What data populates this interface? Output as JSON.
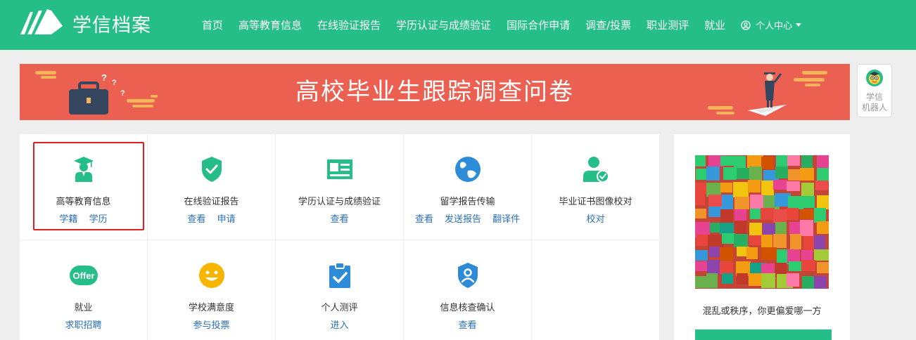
{
  "header": {
    "logo_text": "学信档案",
    "nav": [
      "首页",
      "高等教育信息",
      "在线验证报告",
      "学历认证与成绩验证",
      "国际合作申请",
      "调查/投票",
      "职业测评",
      "就业"
    ],
    "user_center": "个人中心",
    "brand_color": "#25bd88"
  },
  "banner": {
    "title": "高校毕业生跟踪调查问卷",
    "color": "#ec6052"
  },
  "robot": {
    "label_line1": "学信",
    "label_line2": "机器人"
  },
  "services": {
    "items": [
      {
        "title": "高等教育信息",
        "icon": "graduate-icon",
        "links": [
          "学籍",
          "学历"
        ],
        "highlighted": true
      },
      {
        "title": "在线验证报告",
        "icon": "shield-check-icon",
        "links": [
          "查看",
          "申请"
        ]
      },
      {
        "title": "学历认证与成绩验证",
        "icon": "id-card-icon",
        "links": [
          "查看"
        ]
      },
      {
        "title": "留学报告传输",
        "icon": "globe-icon",
        "links": [
          "查看",
          "发送报告",
          "翻译件"
        ]
      },
      {
        "title": "毕业证书图像校对",
        "icon": "user-check-icon",
        "links": [
          "校对"
        ]
      },
      {
        "title": "就业",
        "icon": "offer-icon",
        "icon_text": "Offer",
        "links": [
          "求职招聘"
        ]
      },
      {
        "title": "学校满意度",
        "icon": "smiley-icon",
        "links": [
          "参与投票"
        ]
      },
      {
        "title": "个人测评",
        "icon": "clipboard-check-icon",
        "links": [
          "进入"
        ]
      },
      {
        "title": "信息核查确认",
        "icon": "shield-user-icon",
        "links": [
          "查看"
        ]
      }
    ],
    "link_color": "#2a6fb5"
  },
  "poll": {
    "question": "混乱或秩序，你更偏爱哪一方"
  }
}
